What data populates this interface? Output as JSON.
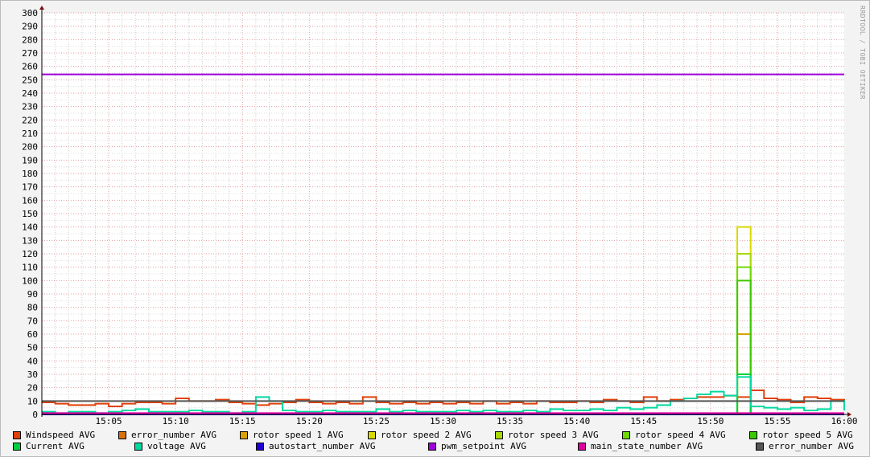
{
  "watermark": "RRDTOOL / TOBI OETIKER",
  "chart_data": {
    "type": "line",
    "xlabel": "",
    "ylabel": "",
    "ylim": [
      0,
      300
    ],
    "yticks": [
      0,
      10,
      20,
      30,
      40,
      50,
      60,
      70,
      80,
      90,
      100,
      110,
      120,
      130,
      140,
      150,
      160,
      170,
      180,
      190,
      200,
      210,
      220,
      230,
      240,
      250,
      260,
      270,
      280,
      290,
      300
    ],
    "xrange_minutes": [
      0,
      60
    ],
    "xstart": "15:00",
    "xticks": [
      {
        "m": 5,
        "label": "15:05"
      },
      {
        "m": 10,
        "label": "15:10"
      },
      {
        "m": 15,
        "label": "15:15"
      },
      {
        "m": 20,
        "label": "15:20"
      },
      {
        "m": 25,
        "label": "15:25"
      },
      {
        "m": 30,
        "label": "15:30"
      },
      {
        "m": 35,
        "label": "15:35"
      },
      {
        "m": 40,
        "label": "15:40"
      },
      {
        "m": 45,
        "label": "15:45"
      },
      {
        "m": 50,
        "label": "15:50"
      },
      {
        "m": 55,
        "label": "15:55"
      },
      {
        "m": 60,
        "label": "16:00"
      }
    ],
    "grid": true,
    "legend_position": "bottom",
    "x_step_minutes": 1,
    "series": [
      {
        "name": "Windspeed AVG",
        "color": "#e0400a",
        "values": [
          9,
          8,
          7,
          7,
          8,
          6,
          8,
          9,
          9,
          8,
          12,
          10,
          10,
          11,
          9,
          8,
          7,
          8,
          9,
          11,
          9,
          8,
          9,
          8,
          13,
          9,
          8,
          9,
          8,
          9,
          8,
          9,
          8,
          10,
          8,
          9,
          8,
          10,
          9,
          9,
          10,
          9,
          11,
          10,
          9,
          13,
          10,
          11,
          12,
          13,
          13,
          14,
          13,
          18,
          12,
          11,
          9,
          13,
          12,
          11,
          9
        ]
      },
      {
        "name": "error_number AVG",
        "color": "#d97008",
        "values": "const:0"
      },
      {
        "name": "rotor speed 1 AVG",
        "color": "#d9a300",
        "spike": {
          "index": 52,
          "value": 60
        }
      },
      {
        "name": "rotor speed 2 AVG",
        "color": "#d9d900",
        "spike": {
          "index": 52,
          "value": 140
        }
      },
      {
        "name": "rotor speed 3 AVG",
        "color": "#a8d900",
        "spike": {
          "index": 52,
          "value": 120
        }
      },
      {
        "name": "rotor speed 4 AVG",
        "color": "#6ed900",
        "spike": {
          "index": 52,
          "value": 110
        }
      },
      {
        "name": "rotor speed 5 AVG",
        "color": "#3cc800",
        "spike": {
          "index": 52,
          "value": 100
        }
      },
      {
        "name": "Current AVG",
        "color": "#00d040",
        "spike": {
          "index": 52,
          "value": 30
        }
      },
      {
        "name": "voltage AVG",
        "color": "#00d9a0",
        "values": [
          2,
          1,
          2,
          2,
          1,
          2,
          3,
          4,
          2,
          2,
          2,
          3,
          2,
          2,
          1,
          2,
          13,
          10,
          3,
          2,
          2,
          3,
          2,
          2,
          2,
          4,
          2,
          3,
          2,
          2,
          2,
          3,
          2,
          3,
          2,
          2,
          3,
          2,
          4,
          3,
          3,
          4,
          3,
          5,
          4,
          5,
          7,
          10,
          12,
          15,
          17,
          14,
          28,
          6,
          5,
          4,
          5,
          3,
          4,
          10,
          3
        ]
      },
      {
        "name": "autostart_number AVG",
        "color": "#2000d9",
        "const": 0
      },
      {
        "name": "pwm_setpoint AVG",
        "color": "#a000d9",
        "const": 254
      },
      {
        "name": "main_state_number AVG",
        "color": "#e000a0",
        "const": 1
      },
      {
        "name": "error_number AVG",
        "color": "#555555",
        "const": 10
      }
    ]
  }
}
